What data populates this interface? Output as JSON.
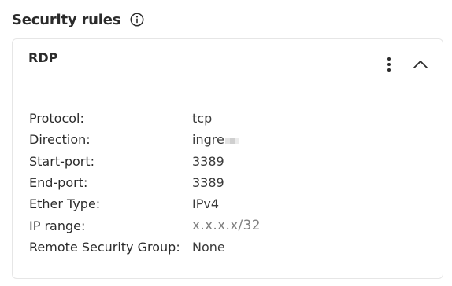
{
  "section": {
    "title": "Security rules",
    "info_icon": "info-circle-icon"
  },
  "card": {
    "title": "RDP",
    "menu_icon": "kebab-menu-icon",
    "collapse_icon": "chevron-up-icon",
    "rows": [
      {
        "label": "Protocol:",
        "value": "tcp"
      },
      {
        "label": "Direction:",
        "value": "ingre"
      },
      {
        "label": "Start-port:",
        "value": "3389"
      },
      {
        "label": "End-port:",
        "value": "3389"
      },
      {
        "label": "Ether Type:",
        "value": "IPv4"
      },
      {
        "label": "IP range:",
        "value": "x.x.x.x/32"
      },
      {
        "label": "Remote Security Group:",
        "value": "None"
      }
    ]
  },
  "colors": {
    "text": "#2b2b2b",
    "muted": "#808080",
    "border": "#e6e6e6"
  }
}
